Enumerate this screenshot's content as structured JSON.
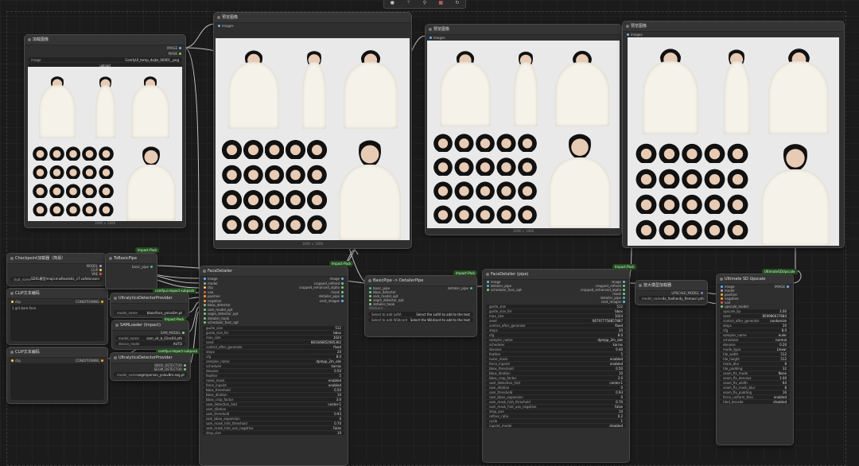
{
  "toolbar": {
    "icons": [
      "circle-icon",
      "wand-icon",
      "pin-icon",
      "delete-icon",
      "refresh-icon"
    ]
  },
  "load_image": {
    "title": "加载图像",
    "out_image": "IMAGE",
    "out_mask": "MASK",
    "image_label": "image",
    "image_value": "ComfyUI_temp_dxjke_00001_.png",
    "upload": "upload",
    "size": "1696 × 1696"
  },
  "preview1": {
    "title": "预览图像",
    "in_images": "images",
    "size": "1696 × 1696"
  },
  "preview2": {
    "title": "预览图像",
    "in_images": "images",
    "size": "1696 × 1696"
  },
  "preview3": {
    "title": "预览图像",
    "in_images": "images"
  },
  "checkpoint": {
    "title": "Checkpoint加载器（简易）",
    "out_model": "MODEL",
    "out_clip": "CLIP",
    "out_vae": "VAE",
    "ckpt_label": "ckpt_name",
    "ckpt_value": "SDXL模型/majicmixRealistic_v7.safetensors"
  },
  "clip1": {
    "title": "CLIP文本编码",
    "in_clip": "clip",
    "out": "CONDITIONING",
    "text": "1 girl,bare face"
  },
  "clip2": {
    "title": "CLIP文本编码",
    "in_clip": "clip",
    "out": "CONDITIONING"
  },
  "tobasic": {
    "title": "ToBasicPipe",
    "badge": "Impact-Pack",
    "out": "basic_pipe"
  },
  "ultra_bbox": {
    "title": "UltralyticsDetectorProvider",
    "badge": "comfyui-impact-subpack",
    "model_label": "model_name",
    "model_value": "bbox/face_yolov8m.pt"
  },
  "sam": {
    "title": "SAMLoader (Impact)",
    "badge": "Impact-Pack",
    "out": "SAM_MODEL",
    "model_label": "model_name",
    "model_value": "sam_vit_b_01ec64.pth",
    "device_label": "device_mode",
    "device_value": "AUTO"
  },
  "ultra_seg": {
    "title": "UltralyticsDetectorProvider",
    "badge": "comfyui-impact-subpack",
    "out1": "BBOX_DETECTOR",
    "out2": "SEGM_DETECTOR",
    "model_label": "model_name",
    "model_value": "segm/person_yolov8m-seg.pt"
  },
  "facedetailer": {
    "title": "FaceDetailer",
    "badge": "Impact-Pack",
    "inputs": [
      "image",
      "model",
      "clip",
      "vae",
      "positive",
      "negative",
      "bbox_detector",
      "sam_model_opt",
      "segm_detector_opt",
      "detailer_hook",
      "scheduler_func_opt"
    ],
    "outputs": [
      "image",
      "cropped_refined",
      "cropped_enhanced_alpha",
      "mask",
      "detailer_pipe",
      "cnet_images"
    ],
    "widgets": [
      [
        "guide_size",
        "512"
      ],
      [
        "guide_size_for",
        "bbox"
      ],
      [
        "max_size",
        "1024"
      ],
      [
        "seed",
        "881648852085362"
      ],
      [
        "control_after_generate",
        "fixed"
      ],
      [
        "steps",
        "20"
      ],
      [
        "cfg",
        "8.0"
      ],
      [
        "sampler_name",
        "dpmpp_2m_sde"
      ],
      [
        "scheduler",
        "karras"
      ],
      [
        "denoise",
        "0.50"
      ],
      [
        "feather",
        "5"
      ],
      [
        "noise_mask",
        "enabled"
      ],
      [
        "force_inpaint",
        "enabled"
      ],
      [
        "bbox_threshold",
        "0.50"
      ],
      [
        "bbox_dilation",
        "10"
      ],
      [
        "bbox_crop_factor",
        "3.0"
      ],
      [
        "sam_detection_hint",
        "center-1"
      ],
      [
        "sam_dilation",
        "0"
      ],
      [
        "sam_threshold",
        "0.93"
      ],
      [
        "sam_bbox_expansion",
        "0"
      ],
      [
        "sam_mask_hint_threshold",
        "0.70"
      ],
      [
        "sam_mask_hint_use_negative",
        "False"
      ],
      [
        "drop_size",
        "10"
      ]
    ]
  },
  "basicpipe": {
    "title": "BasicPipe -> DetailerPipe",
    "badge": "Impact-Pack",
    "inputs": [
      "basic_pipe",
      "bbox_detector",
      "sam_model_opt",
      "segm_detector_opt",
      "detailer_hook"
    ],
    "out": "detailer_pipe",
    "wildcard": "Wildcard ...",
    "lora": "Select to add LoRA",
    "lora_value": "Select the LoRA to add to the text",
    "wild_label": "Select to add Wildcard",
    "wild_value": "Select the Wildcard to add to the text"
  },
  "facedetailer_pipe": {
    "title": "FaceDetailer (pipe)",
    "badge": "Impact-Pack",
    "inputs": [
      "image",
      "detailer_pipe",
      "scheduler_func_opt"
    ],
    "outputs": [
      "image",
      "cropped_refined",
      "cropped_enhanced_alpha",
      "mask",
      "detailer_pipe",
      "cnet_images"
    ],
    "widgets": [
      [
        "guide_size",
        "512"
      ],
      [
        "guide_size_for",
        "bbox"
      ],
      [
        "max_size",
        "1024"
      ],
      [
        "seed",
        "667977758857887"
      ],
      [
        "control_after_generate",
        "fixed"
      ],
      [
        "steps",
        "20"
      ],
      [
        "cfg",
        "8.0"
      ],
      [
        "sampler_name",
        "dpmpp_2m_sde"
      ],
      [
        "scheduler",
        "karras"
      ],
      [
        "denoise",
        "0.40"
      ],
      [
        "feather",
        "5"
      ],
      [
        "noise_mask",
        "enabled"
      ],
      [
        "force_inpaint",
        "enabled"
      ],
      [
        "bbox_threshold",
        "0.50"
      ],
      [
        "bbox_dilation",
        "10"
      ],
      [
        "bbox_crop_factor",
        "3.0"
      ],
      [
        "sam_detection_hint",
        "center-1"
      ],
      [
        "sam_dilation",
        "0"
      ],
      [
        "sam_threshold",
        "0.93"
      ],
      [
        "sam_bbox_expansion",
        "0"
      ],
      [
        "sam_mask_hint_threshold",
        "0.70"
      ],
      [
        "sam_mask_hint_use_negative",
        "False"
      ],
      [
        "drop_size",
        "10"
      ],
      [
        "refiner_ratio",
        "0.2"
      ],
      [
        "cycle",
        "1"
      ],
      [
        "inpaint_model",
        "disabled"
      ]
    ]
  },
  "upscale_loader": {
    "title": "放大模型加载器",
    "out": "UPSCALE_MODEL",
    "model_label": "model_name",
    "model_value": "4x_foolhardy_Remacri.pth"
  },
  "ultimate": {
    "title": "Ultimate SD Upscale",
    "badge": "UltimateSDUpscale",
    "inputs": [
      "image",
      "model",
      "positive",
      "negative",
      "vae",
      "upscale_model"
    ],
    "out": "IMAGE",
    "widgets": [
      [
        "upscale_by",
        "2.00"
      ],
      [
        "seed",
        "859986637684"
      ],
      [
        "control_after_generate",
        "randomize"
      ],
      [
        "steps",
        "20"
      ],
      [
        "cfg",
        "8.0"
      ],
      [
        "sampler_name",
        "euler"
      ],
      [
        "scheduler",
        "normal"
      ],
      [
        "denoise",
        "0.20"
      ],
      [
        "mode_type",
        "Linear"
      ],
      [
        "tile_width",
        "512"
      ],
      [
        "tile_height",
        "512"
      ],
      [
        "mask_blur",
        "8"
      ],
      [
        "tile_padding",
        "32"
      ],
      [
        "seam_fix_mode",
        "None"
      ],
      [
        "seam_fix_denoise",
        "1.00"
      ],
      [
        "seam_fix_width",
        "64"
      ],
      [
        "seam_fix_mask_blur",
        "8"
      ],
      [
        "seam_fix_padding",
        "16"
      ],
      [
        "force_uniform_tiles",
        "enabled"
      ],
      [
        "tiled_decode",
        "disabled"
      ]
    ]
  },
  "colors": {
    "image": "#64b5f6",
    "model": "#b39ddb",
    "clip": "#ffd54f",
    "vae": "#ef5350",
    "cond": "#ffa726",
    "detector": "#81c784",
    "pipe": "#4db6ac",
    "link": "#e0e0e0"
  }
}
